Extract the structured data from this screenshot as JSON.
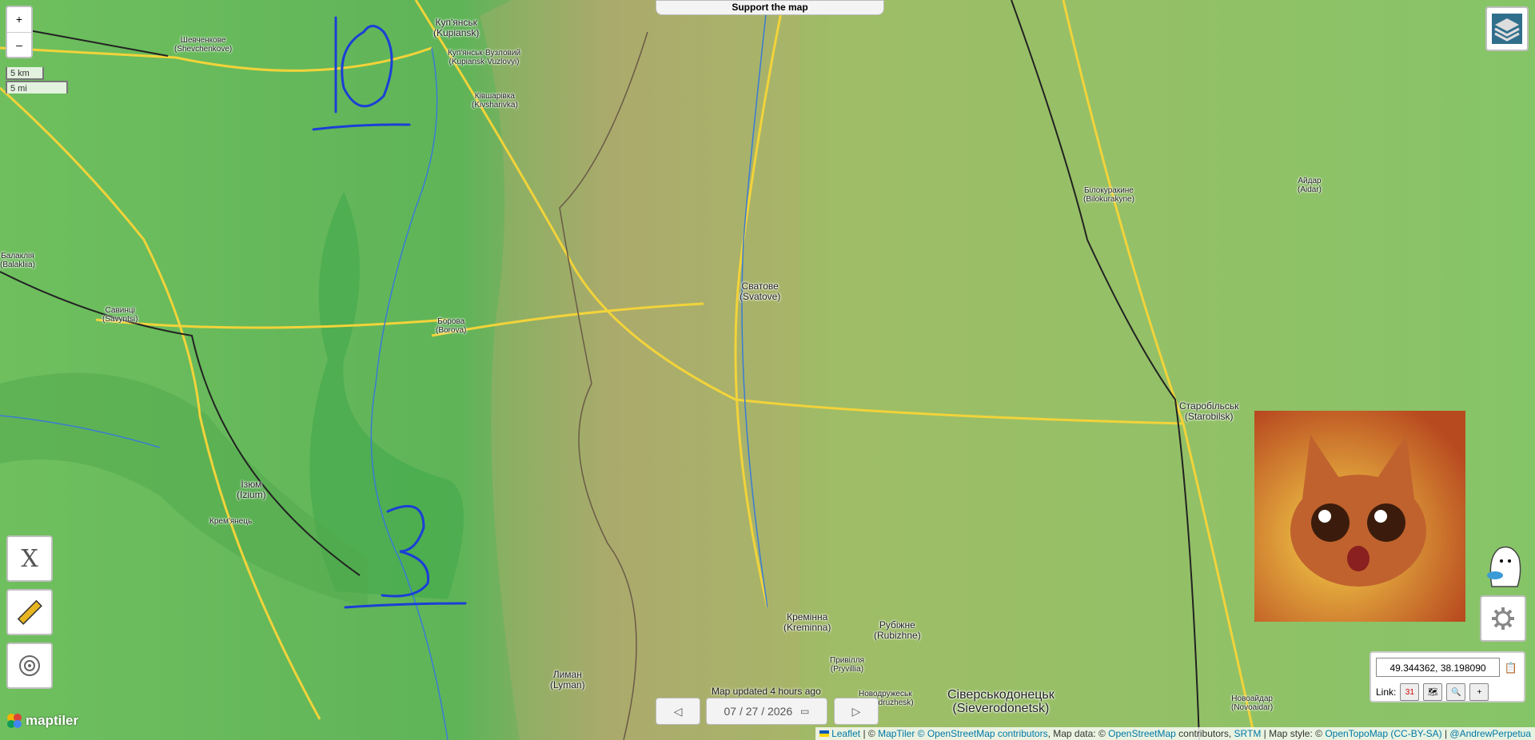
{
  "map": {
    "places": [
      {
        "name": "Куп'янськ",
        "latin": "(Kupiansk)",
        "kind": "city"
      },
      {
        "name": "Куп'янськ-Вузловий",
        "latin": "(Kupiansk-Vuzlovyi)",
        "kind": "town"
      },
      {
        "name": "Ківшарівка",
        "latin": "(Kivsharivka)",
        "kind": "town"
      },
      {
        "name": "Шевченкове",
        "latin": "(Shevchenkove)",
        "kind": "town"
      },
      {
        "name": "Балаклія",
        "latin": "(Balakliia)",
        "kind": "town"
      },
      {
        "name": "Савинці",
        "latin": "(Savyntsi)",
        "kind": "town"
      },
      {
        "name": "Борова",
        "latin": "(Borova)",
        "kind": "town"
      },
      {
        "name": "Ізюм",
        "latin": "(Izium)",
        "kind": "city"
      },
      {
        "name": "Крем'янець",
        "latin": "",
        "kind": "village"
      },
      {
        "name": "Сватове",
        "latin": "(Svatove)",
        "kind": "city"
      },
      {
        "name": "Білокуракине",
        "latin": "(Bilokurakyne)",
        "kind": "town"
      },
      {
        "name": "Айдар",
        "latin": "(Aidar)",
        "kind": "village"
      },
      {
        "name": "Старобільськ",
        "latin": "(Starobilsk)",
        "kind": "city"
      },
      {
        "name": "Кремінна",
        "latin": "(Kreminna)",
        "kind": "city"
      },
      {
        "name": "Рубіжне",
        "latin": "(Rubizhne)",
        "kind": "city"
      },
      {
        "name": "Привілля",
        "latin": "(Pryvillia)",
        "kind": "town"
      },
      {
        "name": "Новодружеськ",
        "latin": "(Novodruzhesk)",
        "kind": "town"
      },
      {
        "name": "Сіверськодонецьк",
        "latin": "(Sieverodonetsk)",
        "kind": "bigcity"
      },
      {
        "name": "Лиман",
        "latin": "(Lyman)",
        "kind": "city"
      },
      {
        "name": "Новоайдар",
        "latin": "(Novoaidar)",
        "kind": "town"
      }
    ],
    "annotations": [
      "10",
      "3"
    ]
  },
  "controls": {
    "zoom_in": "+",
    "zoom_out": "–",
    "scale_km": "5 km",
    "scale_mi": "5 mi",
    "support": "Support the map",
    "x_label": "X",
    "updated": "Map updated 4 hours ago",
    "date": "07 / 27 / 2026",
    "prev": "◁",
    "next": "▷",
    "coords": "49.344362, 38.198090",
    "link_label": "Link:",
    "link_calendar": "31",
    "maptiler": "maptiler"
  },
  "attribution": {
    "leaflet": "Leaflet",
    "sep1": " | © ",
    "maptiler": "MapTiler",
    "osm1": " © OpenStreetMap contributors",
    "data": ", Map data: © ",
    "osm2": "OpenStreetMap",
    "contrib": " contributors, ",
    "srtm": "SRTM",
    "style": " | Map style: © ",
    "otm": "OpenTopoMap",
    "ccbysa": " (CC-BY-SA)",
    "sep2": " | ",
    "author": "@AndrewPerpetua"
  },
  "colors": {
    "annotation": "#1b3fd6",
    "road": "#f2d33a",
    "border": "#6a5a48",
    "water": "#3a7bd5"
  }
}
